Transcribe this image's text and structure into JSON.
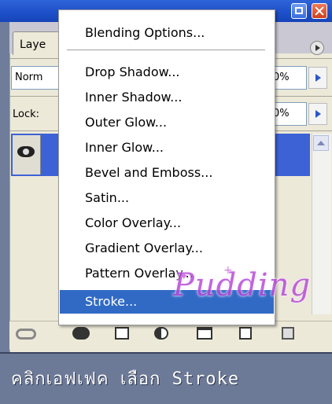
{
  "panel": {
    "tab_label": "Laye",
    "blend_mode_value": "Norm",
    "opacity_value": "0%",
    "lock_label": "Lock:",
    "fill_value": "0%"
  },
  "menu": {
    "items": [
      {
        "label": "Blending Options..."
      },
      {
        "label": "Drop Shadow..."
      },
      {
        "label": "Inner Shadow..."
      },
      {
        "label": "Outer Glow..."
      },
      {
        "label": "Inner Glow..."
      },
      {
        "label": "Bevel and Emboss..."
      },
      {
        "label": "Satin..."
      },
      {
        "label": "Color Overlay..."
      },
      {
        "label": "Gradient Overlay..."
      },
      {
        "label": "Pattern Overlay..."
      },
      {
        "label": "Stroke..."
      }
    ],
    "selected_item": "Stroke..."
  },
  "watermark": {
    "text": "Pudding",
    "color": "#b64bd6"
  },
  "caption": {
    "text": "คลิกเอฟเฟค เลือก Stroke"
  },
  "colors": {
    "titlebar": "#1d4fc8",
    "selection": "#316ac5",
    "panel_bg": "#ece9d8",
    "caption_bg": "#6d7a97"
  }
}
